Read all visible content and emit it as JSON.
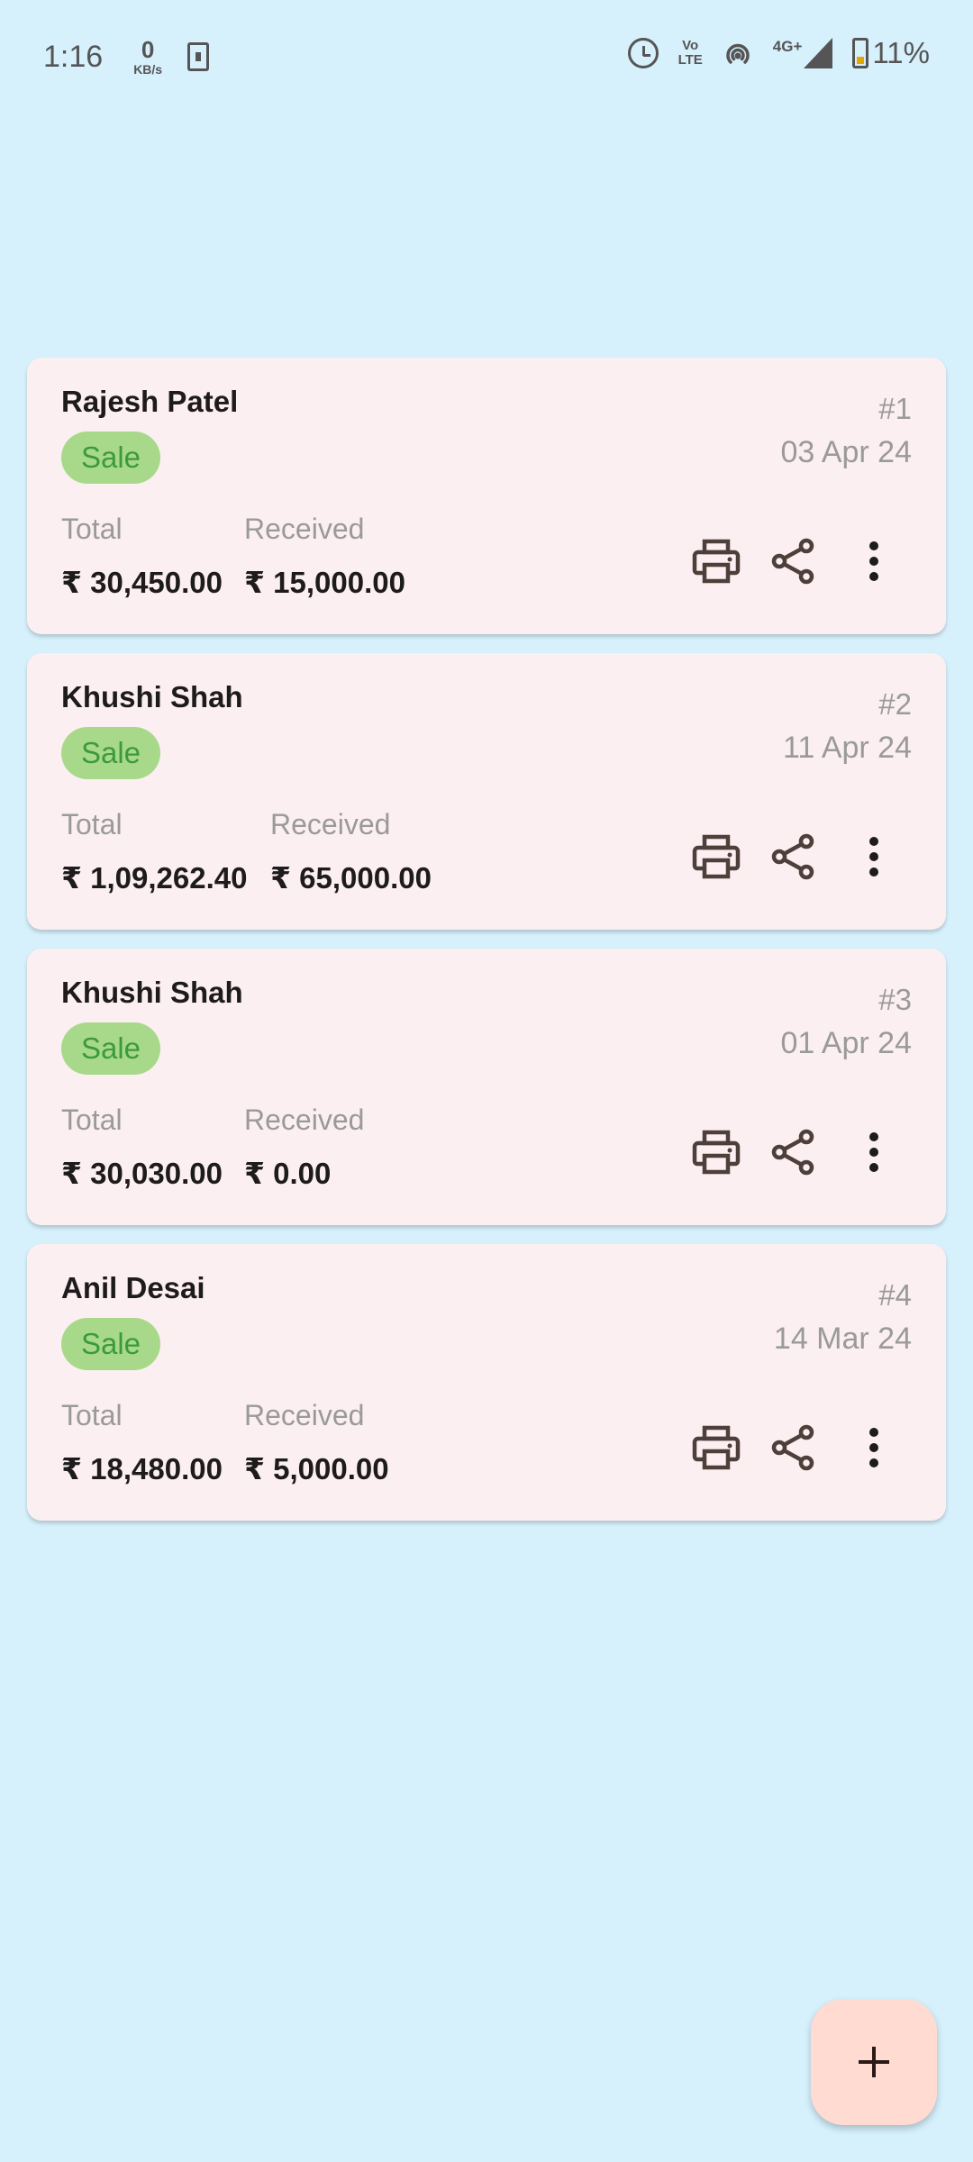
{
  "status_bar": {
    "time": "1:16",
    "net_speed_value": "0",
    "net_speed_unit": "KB/s",
    "volte_line1": "Vo",
    "volte_line2": "LTE",
    "network_type": "4G+",
    "battery": "11%",
    "icons": [
      "alarm-icon",
      "volte-icon",
      "hotspot-icon",
      "signal-icon",
      "battery-icon"
    ]
  },
  "labels": {
    "total": "Total",
    "received": "Received"
  },
  "invoices": [
    {
      "customer": "Rajesh Patel",
      "type": "Sale",
      "number": "#1",
      "date": "03 Apr 24",
      "total": "₹ 30,450.00",
      "received": "₹ 15,000.00"
    },
    {
      "customer": "Khushi Shah",
      "type": "Sale",
      "number": "#2",
      "date": "11 Apr 24",
      "total": "₹ 1,09,262.40",
      "received": "₹ 65,000.00"
    },
    {
      "customer": "Khushi Shah",
      "type": "Sale",
      "number": "#3",
      "date": "01 Apr 24",
      "total": "₹ 30,030.00",
      "received": "₹ 0.00"
    },
    {
      "customer": "Anil Desai",
      "type": "Sale",
      "number": "#4",
      "date": "14 Mar 24",
      "total": "₹ 18,480.00",
      "received": "₹ 5,000.00"
    }
  ],
  "colors": {
    "background": "#d6f0fc",
    "card": "#fbeff1",
    "badge_bg": "#a8d98a",
    "badge_text": "#3c9a3c",
    "fab": "#ffdbd1",
    "icon": "#4e3f3a"
  },
  "fab_icon": "plus-icon"
}
